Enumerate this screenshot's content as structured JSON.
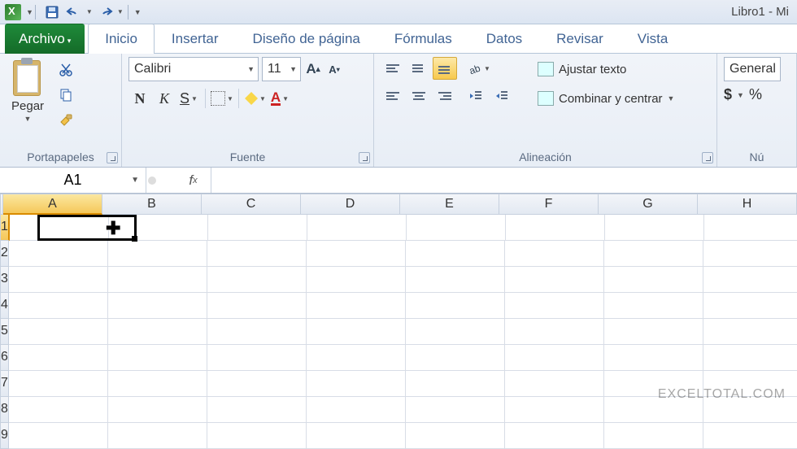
{
  "title": "Libro1 - Mi",
  "qat": {
    "save": "save-icon",
    "undo": "undo-icon",
    "redo": "redo-icon"
  },
  "tabs": {
    "file": "Archivo",
    "items": [
      "Inicio",
      "Insertar",
      "Diseño de página",
      "Fórmulas",
      "Datos",
      "Revisar",
      "Vista"
    ],
    "active": 0
  },
  "ribbon": {
    "clipboard": {
      "label": "Portapapeles",
      "paste": "Pegar"
    },
    "font": {
      "label": "Fuente",
      "name": "Calibri",
      "size": "11",
      "buttons": {
        "bold": "N",
        "italic": "K",
        "underline": "S"
      }
    },
    "alignment": {
      "label": "Alineación",
      "wrap": "Ajustar texto",
      "merge": "Combinar y centrar"
    },
    "number": {
      "label": "Nú",
      "format": "General",
      "currency": "$",
      "percent": "%"
    }
  },
  "namebox": "A1",
  "formula": "",
  "columns": [
    "A",
    "B",
    "C",
    "D",
    "E",
    "F",
    "G",
    "H"
  ],
  "rows": [
    "1",
    "2",
    "3",
    "4",
    "5",
    "6",
    "7",
    "8",
    "9"
  ],
  "active_col": 0,
  "active_row": 0,
  "watermark": "EXCELTOTAL.COM"
}
